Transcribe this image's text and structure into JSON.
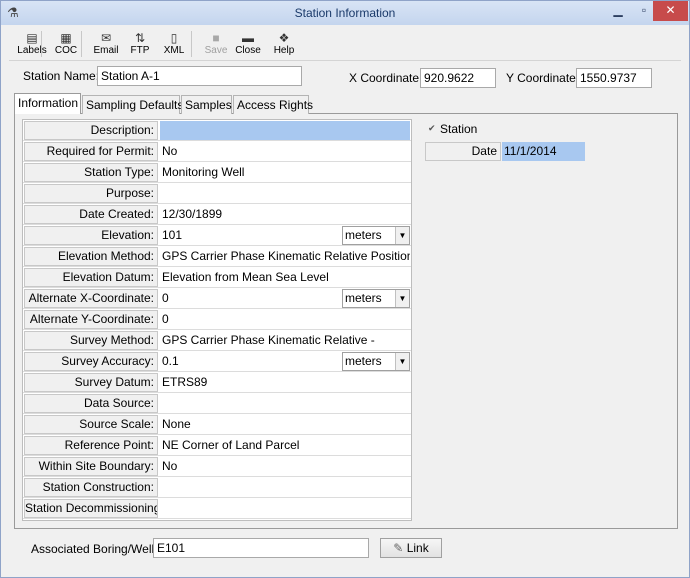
{
  "window": {
    "title": "Station Information",
    "app_icon": "flask-icon"
  },
  "toolbar": [
    {
      "label": "Labels",
      "icon": "labels-icon",
      "glyph": "▤"
    },
    {
      "label": "COC",
      "icon": "coc-icon",
      "glyph": "▦"
    },
    {
      "label": "Email",
      "icon": "email-icon",
      "glyph": "✉"
    },
    {
      "label": "FTP",
      "icon": "ftp-icon",
      "glyph": "⇅"
    },
    {
      "label": "XML",
      "icon": "xml-icon",
      "glyph": "▯"
    },
    {
      "label": "Save",
      "icon": "save-icon",
      "glyph": "■",
      "disabled": true
    },
    {
      "label": "Close",
      "icon": "close-folder-icon",
      "glyph": "▬"
    },
    {
      "label": "Help",
      "icon": "help-book-icon",
      "glyph": "❖"
    }
  ],
  "header": {
    "station_name_label": "Station Name:",
    "station_name": "Station A-1",
    "x_label": "X Coordinate:",
    "x_value": "920.9622",
    "y_label": "Y Coordinate:",
    "y_value": "1550.9737"
  },
  "tabs": [
    "Information",
    "Sampling Defaults",
    "Samples",
    "Access Rights"
  ],
  "active_tab": "Information",
  "fields": [
    {
      "label": "Description:",
      "value": "",
      "selected": true
    },
    {
      "label": "Required for Permit:",
      "value": "No"
    },
    {
      "label": "Station Type:",
      "value": "Monitoring Well"
    },
    {
      "label": "Purpose:",
      "value": ""
    },
    {
      "label": "Date Created:",
      "value": "12/30/1899"
    },
    {
      "label": "Elevation:",
      "value": "101",
      "unit": "meters"
    },
    {
      "label": "Elevation Method:",
      "value": "GPS Carrier Phase Kinematic Relative Positioning"
    },
    {
      "label": "Elevation Datum:",
      "value": "Elevation from Mean Sea Level"
    },
    {
      "label": "Alternate X-Coordinate:",
      "value": "0",
      "unit": "meters"
    },
    {
      "label": "Alternate Y-Coordinate:",
      "value": "0"
    },
    {
      "label": "Survey Method:",
      "value": "GPS Carrier Phase Kinematic Relative -"
    },
    {
      "label": "Survey Accuracy:",
      "value": "0.1",
      "unit": "meters"
    },
    {
      "label": "Survey Datum:",
      "value": "ETRS89"
    },
    {
      "label": "Data Source:",
      "value": ""
    },
    {
      "label": "Source Scale:",
      "value": "None"
    },
    {
      "label": "Reference Point:",
      "value": "NE Corner of Land Parcel"
    },
    {
      "label": "Within Site Boundary:",
      "value": "No"
    },
    {
      "label": "Station Construction:",
      "value": ""
    },
    {
      "label": "Station Decommissioning:",
      "value": ""
    }
  ],
  "side": {
    "station_check_label": "Station",
    "date_label": "Date",
    "date_value": "11/1/2014"
  },
  "footer": {
    "boring_label": "Associated Boring/Well:",
    "boring_value": "E101",
    "link_label": "Link",
    "link_icon": "pencil-icon"
  }
}
